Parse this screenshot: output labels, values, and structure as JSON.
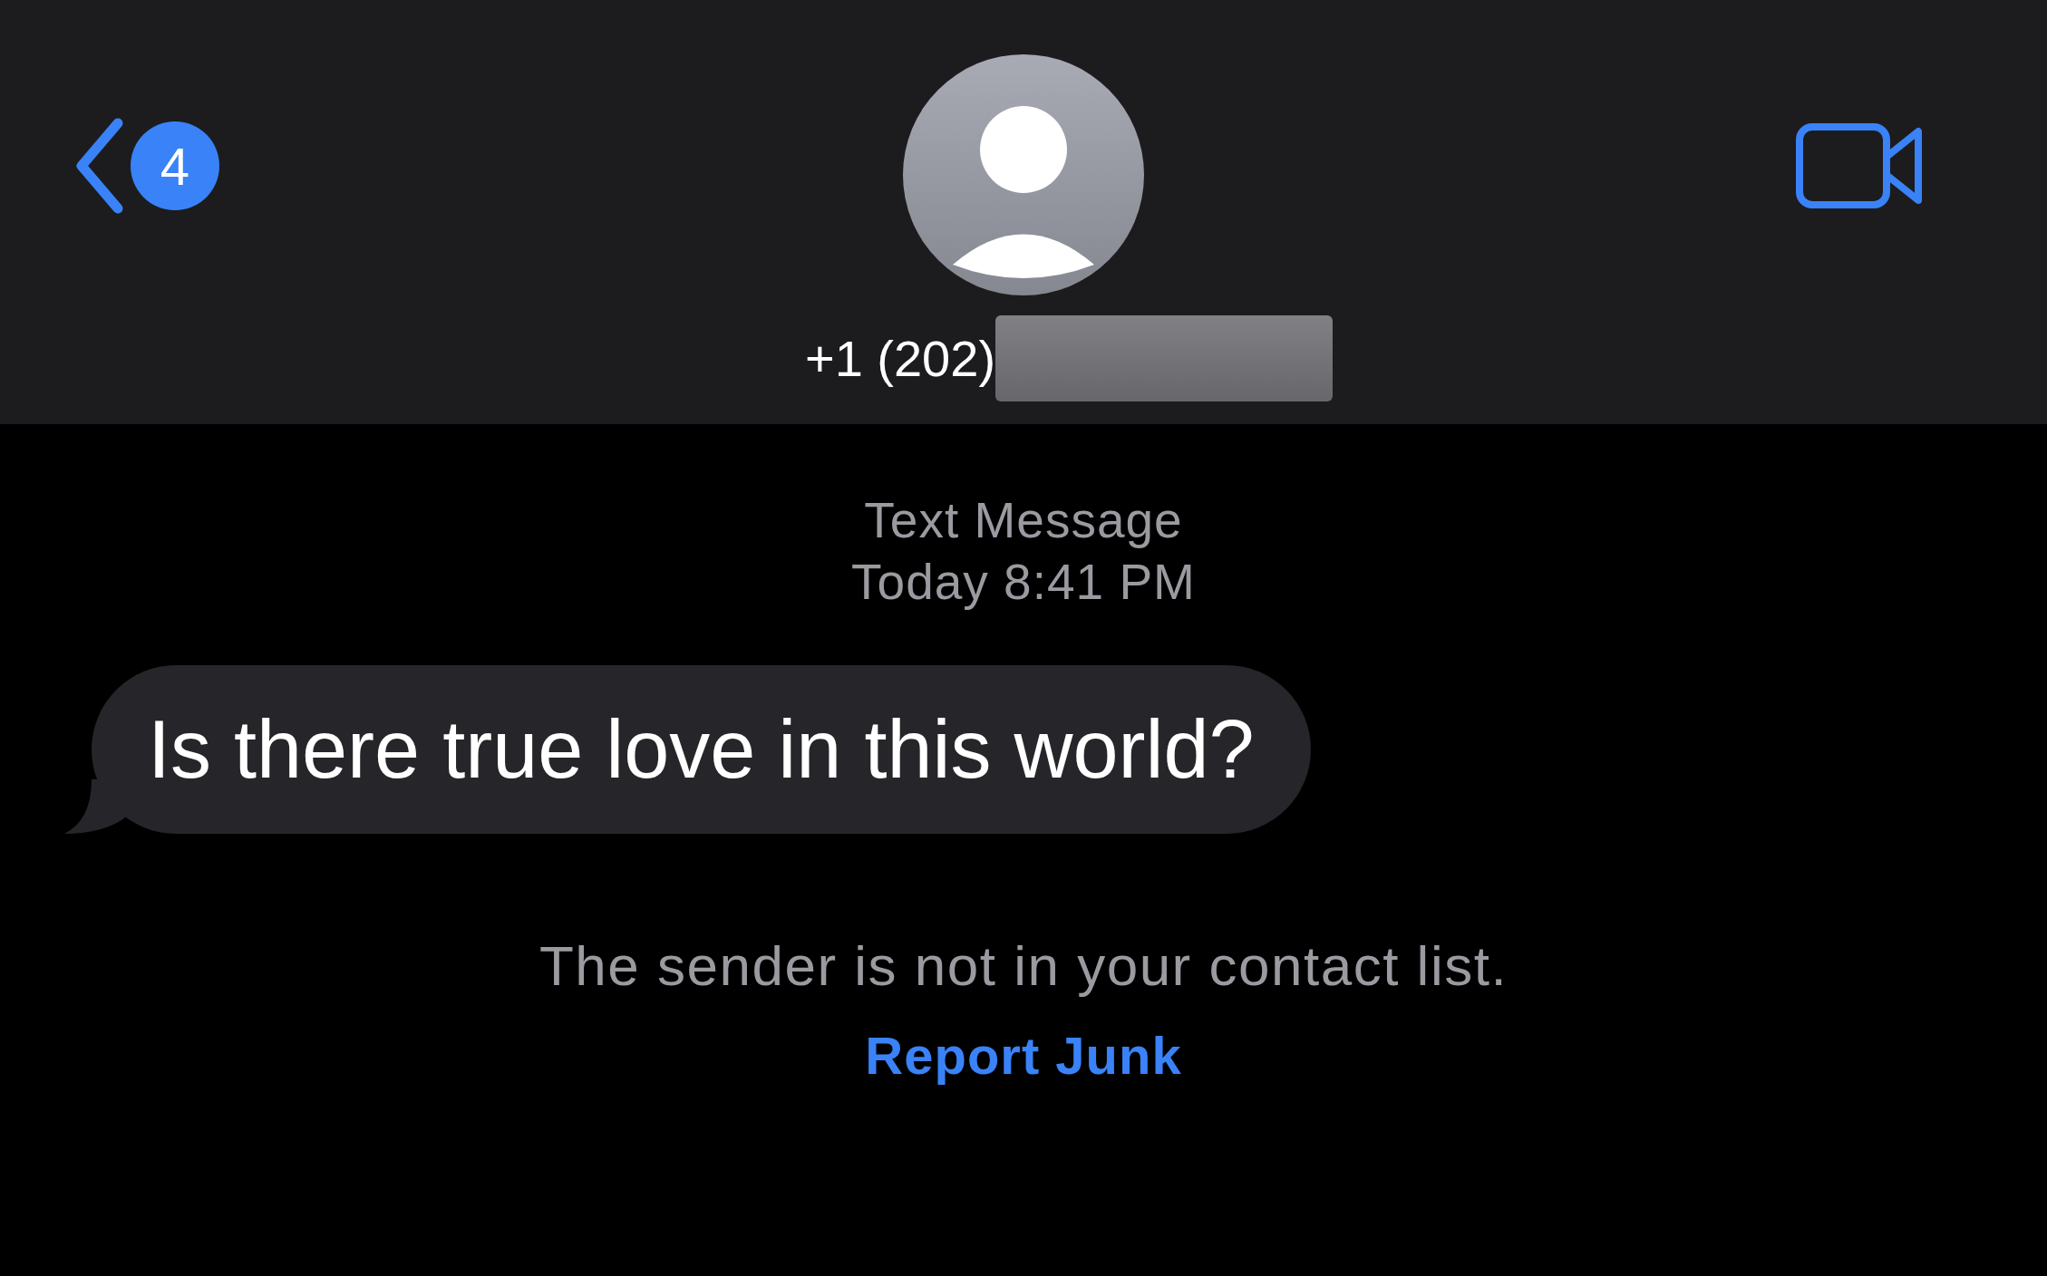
{
  "header": {
    "back_badge": "4",
    "contact": "+1 (202)",
    "contact_redacted": true
  },
  "thread": {
    "service": "Text Message",
    "timestamp": "Today 8:41 PM"
  },
  "messages": [
    {
      "text": "Is there true love in this world?",
      "outgoing": false
    }
  ],
  "notice": {
    "text": "The sender is not in your contact list.",
    "action": "Report Junk"
  }
}
